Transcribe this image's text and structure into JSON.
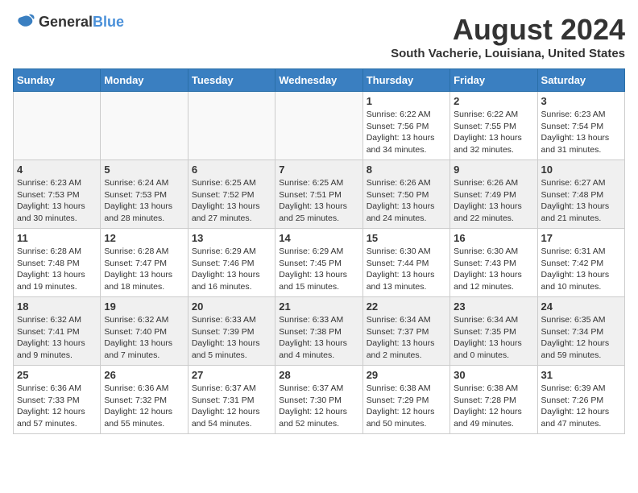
{
  "logo": {
    "line1": "General",
    "line2": "Blue"
  },
  "title": "August 2024",
  "subtitle": "South Vacherie, Louisiana, United States",
  "days_of_week": [
    "Sunday",
    "Monday",
    "Tuesday",
    "Wednesday",
    "Thursday",
    "Friday",
    "Saturday"
  ],
  "weeks": [
    [
      {
        "day": "",
        "info": ""
      },
      {
        "day": "",
        "info": ""
      },
      {
        "day": "",
        "info": ""
      },
      {
        "day": "",
        "info": ""
      },
      {
        "day": "1",
        "info": "Sunrise: 6:22 AM\nSunset: 7:56 PM\nDaylight: 13 hours and 34 minutes."
      },
      {
        "day": "2",
        "info": "Sunrise: 6:22 AM\nSunset: 7:55 PM\nDaylight: 13 hours and 32 minutes."
      },
      {
        "day": "3",
        "info": "Sunrise: 6:23 AM\nSunset: 7:54 PM\nDaylight: 13 hours and 31 minutes."
      }
    ],
    [
      {
        "day": "4",
        "info": "Sunrise: 6:23 AM\nSunset: 7:53 PM\nDaylight: 13 hours and 30 minutes."
      },
      {
        "day": "5",
        "info": "Sunrise: 6:24 AM\nSunset: 7:53 PM\nDaylight: 13 hours and 28 minutes."
      },
      {
        "day": "6",
        "info": "Sunrise: 6:25 AM\nSunset: 7:52 PM\nDaylight: 13 hours and 27 minutes."
      },
      {
        "day": "7",
        "info": "Sunrise: 6:25 AM\nSunset: 7:51 PM\nDaylight: 13 hours and 25 minutes."
      },
      {
        "day": "8",
        "info": "Sunrise: 6:26 AM\nSunset: 7:50 PM\nDaylight: 13 hours and 24 minutes."
      },
      {
        "day": "9",
        "info": "Sunrise: 6:26 AM\nSunset: 7:49 PM\nDaylight: 13 hours and 22 minutes."
      },
      {
        "day": "10",
        "info": "Sunrise: 6:27 AM\nSunset: 7:48 PM\nDaylight: 13 hours and 21 minutes."
      }
    ],
    [
      {
        "day": "11",
        "info": "Sunrise: 6:28 AM\nSunset: 7:48 PM\nDaylight: 13 hours and 19 minutes."
      },
      {
        "day": "12",
        "info": "Sunrise: 6:28 AM\nSunset: 7:47 PM\nDaylight: 13 hours and 18 minutes."
      },
      {
        "day": "13",
        "info": "Sunrise: 6:29 AM\nSunset: 7:46 PM\nDaylight: 13 hours and 16 minutes."
      },
      {
        "day": "14",
        "info": "Sunrise: 6:29 AM\nSunset: 7:45 PM\nDaylight: 13 hours and 15 minutes."
      },
      {
        "day": "15",
        "info": "Sunrise: 6:30 AM\nSunset: 7:44 PM\nDaylight: 13 hours and 13 minutes."
      },
      {
        "day": "16",
        "info": "Sunrise: 6:30 AM\nSunset: 7:43 PM\nDaylight: 13 hours and 12 minutes."
      },
      {
        "day": "17",
        "info": "Sunrise: 6:31 AM\nSunset: 7:42 PM\nDaylight: 13 hours and 10 minutes."
      }
    ],
    [
      {
        "day": "18",
        "info": "Sunrise: 6:32 AM\nSunset: 7:41 PM\nDaylight: 13 hours and 9 minutes."
      },
      {
        "day": "19",
        "info": "Sunrise: 6:32 AM\nSunset: 7:40 PM\nDaylight: 13 hours and 7 minutes."
      },
      {
        "day": "20",
        "info": "Sunrise: 6:33 AM\nSunset: 7:39 PM\nDaylight: 13 hours and 5 minutes."
      },
      {
        "day": "21",
        "info": "Sunrise: 6:33 AM\nSunset: 7:38 PM\nDaylight: 13 hours and 4 minutes."
      },
      {
        "day": "22",
        "info": "Sunrise: 6:34 AM\nSunset: 7:37 PM\nDaylight: 13 hours and 2 minutes."
      },
      {
        "day": "23",
        "info": "Sunrise: 6:34 AM\nSunset: 7:35 PM\nDaylight: 13 hours and 0 minutes."
      },
      {
        "day": "24",
        "info": "Sunrise: 6:35 AM\nSunset: 7:34 PM\nDaylight: 12 hours and 59 minutes."
      }
    ],
    [
      {
        "day": "25",
        "info": "Sunrise: 6:36 AM\nSunset: 7:33 PM\nDaylight: 12 hours and 57 minutes."
      },
      {
        "day": "26",
        "info": "Sunrise: 6:36 AM\nSunset: 7:32 PM\nDaylight: 12 hours and 55 minutes."
      },
      {
        "day": "27",
        "info": "Sunrise: 6:37 AM\nSunset: 7:31 PM\nDaylight: 12 hours and 54 minutes."
      },
      {
        "day": "28",
        "info": "Sunrise: 6:37 AM\nSunset: 7:30 PM\nDaylight: 12 hours and 52 minutes."
      },
      {
        "day": "29",
        "info": "Sunrise: 6:38 AM\nSunset: 7:29 PM\nDaylight: 12 hours and 50 minutes."
      },
      {
        "day": "30",
        "info": "Sunrise: 6:38 AM\nSunset: 7:28 PM\nDaylight: 12 hours and 49 minutes."
      },
      {
        "day": "31",
        "info": "Sunrise: 6:39 AM\nSunset: 7:26 PM\nDaylight: 12 hours and 47 minutes."
      }
    ]
  ]
}
